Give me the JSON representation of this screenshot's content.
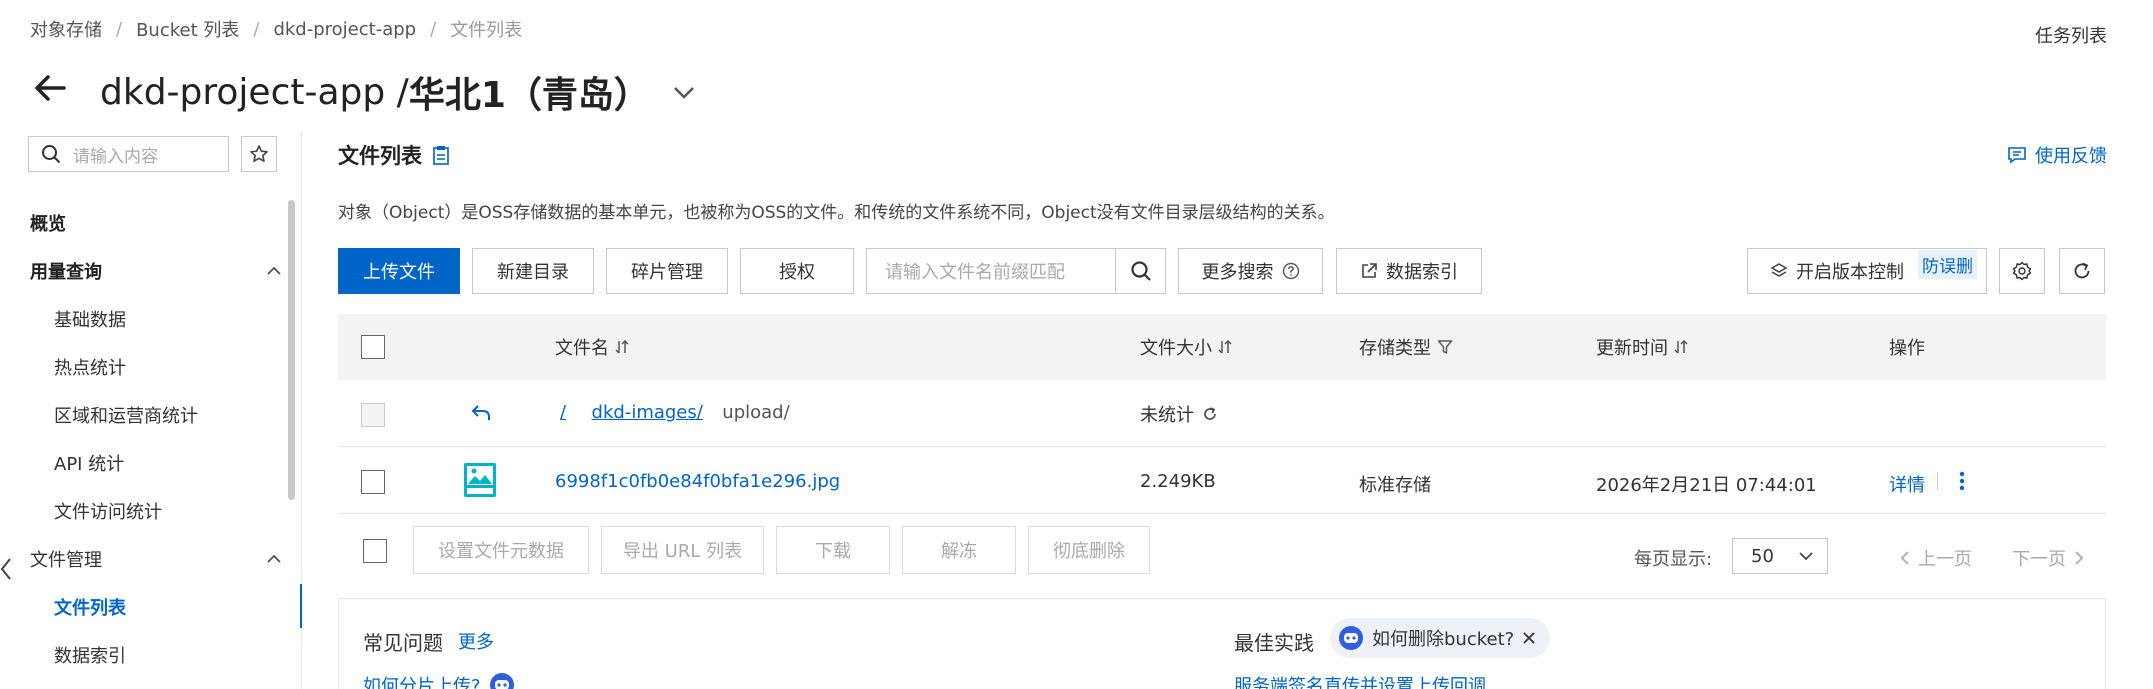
{
  "breadcrumb": [
    "对象存储",
    "Bucket 列表",
    "dkd-project-app",
    "文件列表"
  ],
  "task_list": "任务列表",
  "title": {
    "bucket": "dkd-project-app / ",
    "region": "华北1（青岛）"
  },
  "sidebar": {
    "search_placeholder": "请输入内容",
    "overview": "概览",
    "usage_group": "用量查询",
    "usage_items": [
      "基础数据",
      "热点统计",
      "区域和运营商统计",
      "API 统计",
      "文件访问统计"
    ],
    "files_group": "文件管理",
    "files_items": [
      "文件列表",
      "数据索引"
    ]
  },
  "main": {
    "section_title": "文件列表",
    "feedback": "使用反馈",
    "description": "对象（Object）是OSS存储数据的基本单元，也被称为OSS的文件。和传统的文件系统不同，Object没有文件目录层级结构的关系。",
    "toolbar": {
      "upload": "上传文件",
      "new_dir": "新建目录",
      "fragments": "碎片管理",
      "authorize": "授权",
      "search_placeholder": "请输入文件名前缀匹配",
      "more_search": "更多搜索",
      "data_index": "数据索引",
      "versioning": "开启版本控制",
      "anti_delete": "防误删"
    },
    "table": {
      "headers": {
        "name": "文件名",
        "size": "文件大小",
        "storage": "存储类型",
        "updated": "更新时间",
        "actions": "操作"
      },
      "path_row": {
        "root": "/",
        "dir": "dkd-images/",
        "current": "upload/",
        "size": "未统计"
      },
      "rows": [
        {
          "name": "6998f1c0fb0e84f0bfa1e296.jpg",
          "size": "2.249KB",
          "storage": "标准存储",
          "updated": "2026年2月21日 07:44:01",
          "detail": "详情"
        }
      ]
    },
    "batch": [
      "设置文件元数据",
      "导出 URL 列表",
      "下载",
      "解冻",
      "彻底删除"
    ],
    "pagination": {
      "label": "每页显示:",
      "size": "50",
      "prev": "上一页",
      "next": "下一页"
    },
    "faq": {
      "title": "常见问题",
      "more": "更多",
      "best_title": "最佳实践",
      "chip": "如何删除bucket?",
      "link1": "如何分片上传?",
      "link2": "服务端签名直传并设置上传回调"
    }
  }
}
